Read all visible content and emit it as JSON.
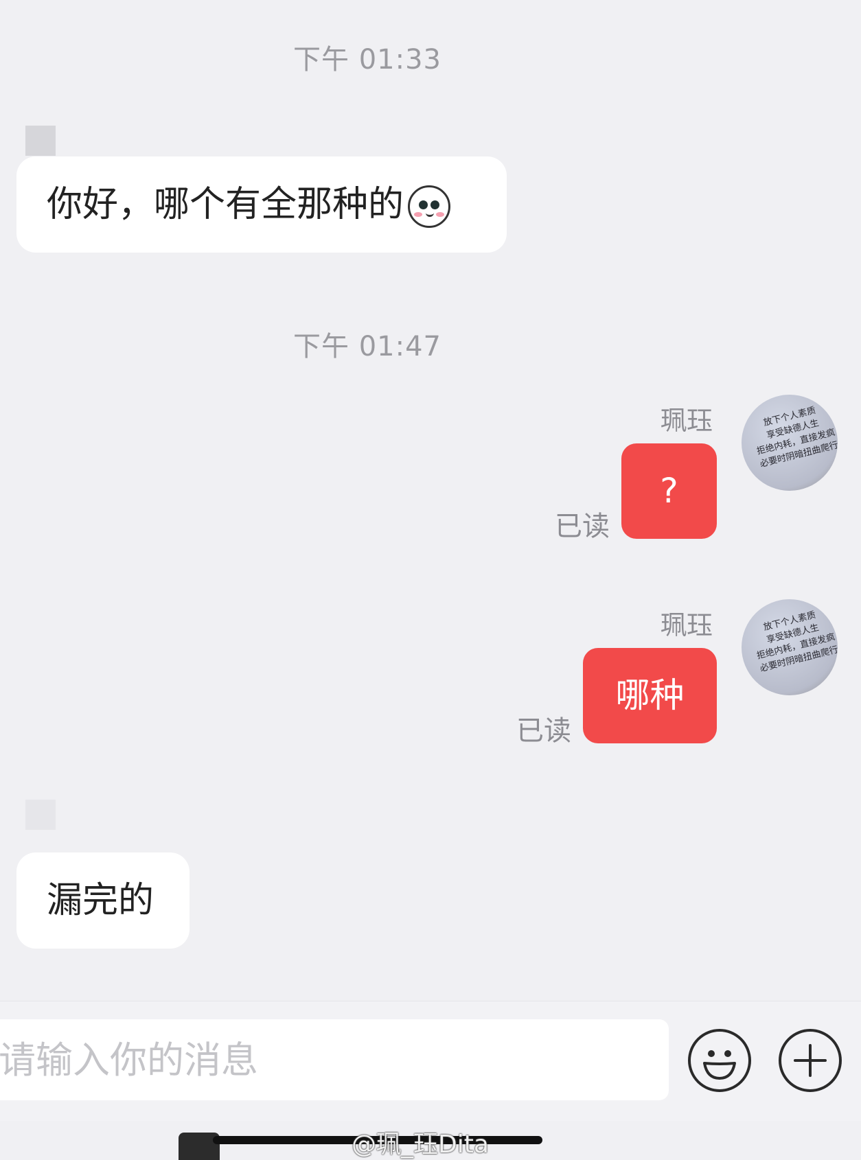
{
  "messages": {
    "timestamp_1": "下午 01:33",
    "incoming_1": "你好，哪个有全那种的",
    "incoming_1_emoji": "seal-emoji",
    "timestamp_2": "下午 01:47",
    "outgoing_1": {
      "sender_name": "珮珏",
      "text": "?",
      "status": "已读"
    },
    "outgoing_2": {
      "sender_name": "珮珏",
      "text": "哪种",
      "status": "已读"
    },
    "incoming_2": "漏完的"
  },
  "avatar": {
    "lines": [
      "放下个人素质",
      "享受缺德人生",
      "拒绝内耗，直接发疯",
      "必要时阴暗扭曲爬行"
    ]
  },
  "composer": {
    "placeholder": "请输入你的消息",
    "emoji_icon": "smiley-icon",
    "plus_icon": "plus-icon"
  },
  "watermark": "@珮_珏Dita",
  "colors": {
    "background": "#f0f0f3",
    "outgoing_bubble": "#f24a4a",
    "incoming_bubble": "#ffffff",
    "muted_text": "#8c8c92"
  }
}
